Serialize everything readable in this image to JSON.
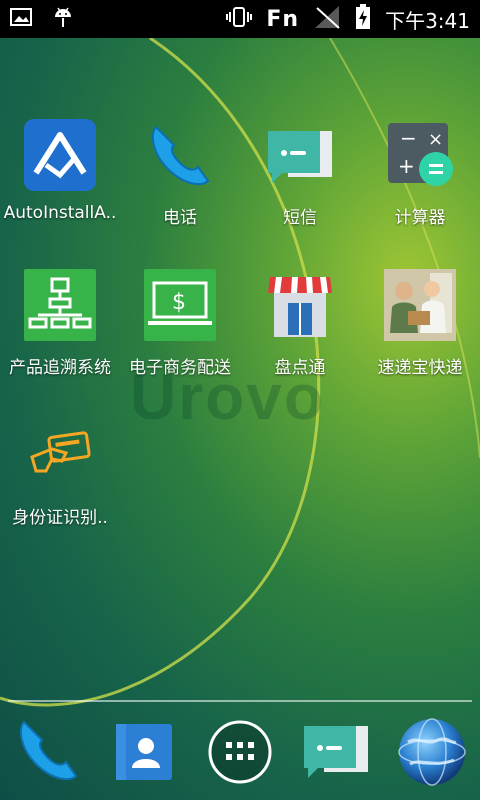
{
  "status_bar": {
    "left_icons": [
      "image-icon",
      "android-icon"
    ],
    "right_icons": [
      "vibrate-icon",
      "fn-indicator",
      "signal-off-icon",
      "battery-charging-icon"
    ],
    "fn_label": "Fn",
    "time": "下午3:41"
  },
  "watermark": "Urovo",
  "apps": [
    {
      "label": "AutoInstallA..",
      "icon": "autoinstall-icon"
    },
    {
      "label": "电话",
      "icon": "phone-icon"
    },
    {
      "label": "短信",
      "icon": "messaging-icon"
    },
    {
      "label": "计算器",
      "icon": "calculator-icon"
    },
    {
      "label": "产品追溯系统",
      "icon": "traceability-icon"
    },
    {
      "label": "电子商务配送",
      "icon": "ecommerce-icon"
    },
    {
      "label": "盘点通",
      "icon": "store-icon"
    },
    {
      "label": "速递宝快递",
      "icon": "courier-icon"
    },
    {
      "label": "身份证识别..",
      "icon": "id-card-icon"
    }
  ],
  "dock": [
    "phone-icon",
    "contacts-icon",
    "all-apps-icon",
    "messaging-icon",
    "browser-globe-icon"
  ],
  "colors": {
    "autoinstall_bg": "#1e6fce",
    "phone_blue": "#1ea0e8",
    "message_teal": "#3fb6a6",
    "green_app": "#37b34a",
    "status_bar": "#000000"
  }
}
